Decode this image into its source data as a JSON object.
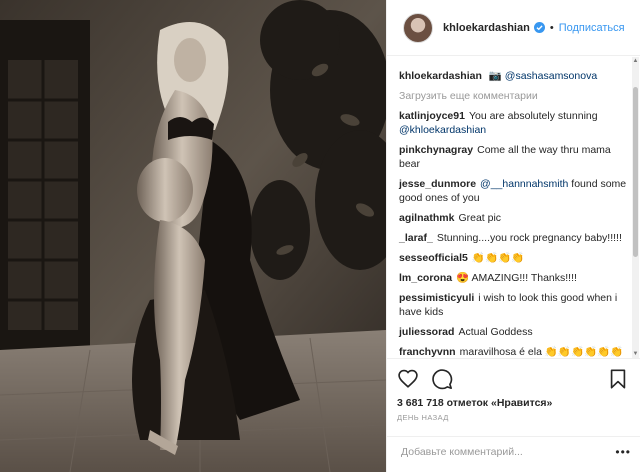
{
  "post": {
    "image_icon": "photo",
    "author": "khloekardashian",
    "follow_label": "Подписаться",
    "separator": "•",
    "caption_icon": "camera-emoji",
    "caption_mention": "@sashasamsonova"
  },
  "load_more_label": "Загрузить еще комментарии",
  "comments": [
    {
      "user": "katlinjoyce91",
      "text": "You are absolutely stunning ",
      "mention": "@khloekardashian"
    },
    {
      "user": "pinkchynagray",
      "text": "Come all the way thru mama bear",
      "mention": ""
    },
    {
      "user": "jesse_dunmore",
      "text": " found some good ones of you",
      "mention": "@__hannnahsmith",
      "mention_first": true
    },
    {
      "user": "agilnathmk",
      "text": "Great pic",
      "mention": ""
    },
    {
      "user": "_laraf_",
      "text": "Stunning....you rock pregnancy baby!!!!!",
      "mention": ""
    },
    {
      "user": "sesseofficial5",
      "text": "👏👏👏👏",
      "mention": ""
    },
    {
      "user": "lm_corona",
      "text": "😍 AMAZING!!! Thanks!!!!",
      "mention": ""
    },
    {
      "user": "pessimisticyuli",
      "text": "i wish to look this good when i have kids",
      "mention": ""
    },
    {
      "user": "juliessorad",
      "text": "Actual Goddess",
      "mention": ""
    },
    {
      "user": "franchyvnn",
      "text": "maravilhosa é ela 👏👏👏👏👏👏",
      "mention": ""
    }
  ],
  "actions": {
    "like_icon": "heart-icon",
    "comment_icon": "comment-icon",
    "save_icon": "bookmark-icon",
    "likes_text": "3 681 718 отметок «Нравится»",
    "time_text": "день назад"
  },
  "add_comment": {
    "placeholder": "Добавьте комментарий...",
    "more_label": "•••"
  },
  "colors": {
    "link": "#3897f0",
    "mention": "#003569",
    "muted": "#999999",
    "verified": "#3897f0"
  }
}
